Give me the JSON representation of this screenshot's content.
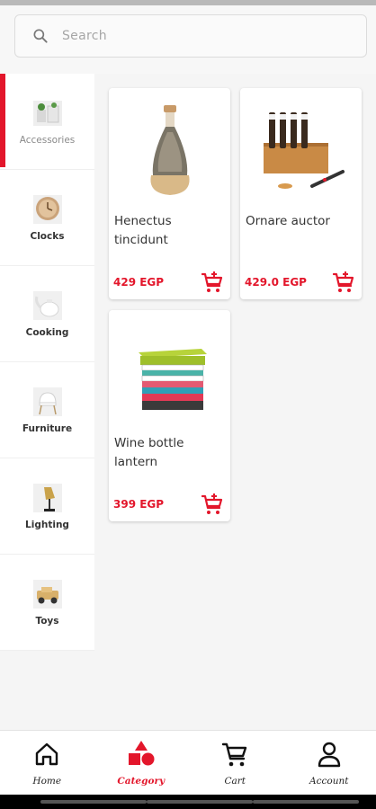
{
  "search": {
    "placeholder": "Search",
    "value": ""
  },
  "sidebar": {
    "items": [
      {
        "label": "Accessories",
        "icon": "accessories-thumb-icon",
        "active": true
      },
      {
        "label": "Clocks",
        "icon": "clock-thumb-icon",
        "active": false
      },
      {
        "label": "Cooking",
        "icon": "cooking-thumb-icon",
        "active": false
      },
      {
        "label": "Furniture",
        "icon": "chair-thumb-icon",
        "active": false
      },
      {
        "label": "Lighting",
        "icon": "lamp-thumb-icon",
        "active": false
      },
      {
        "label": "Toys",
        "icon": "toy-car-thumb-icon",
        "active": false
      }
    ]
  },
  "products": [
    {
      "name": "Henectus tincidunt",
      "price": "429 EGP",
      "image": "glass-bottle-image"
    },
    {
      "name": "Ornare auctor",
      "price": "429.0 EGP",
      "image": "bamboo-rack-image"
    },
    {
      "name": "Wine bottle lantern",
      "price": "399 EGP",
      "image": "stacked-boxes-image"
    }
  ],
  "bottom_nav": {
    "items": [
      {
        "label": "Home",
        "icon": "home-icon",
        "active": false
      },
      {
        "label": "Category",
        "icon": "category-shapes-icon",
        "active": true
      },
      {
        "label": "Cart",
        "icon": "cart-icon",
        "active": false
      },
      {
        "label": "Account",
        "icon": "account-icon",
        "active": false
      }
    ]
  },
  "colors": {
    "accent": "#e3162b",
    "background": "#f5f5f5",
    "card": "#ffffff",
    "text": "#333333"
  }
}
